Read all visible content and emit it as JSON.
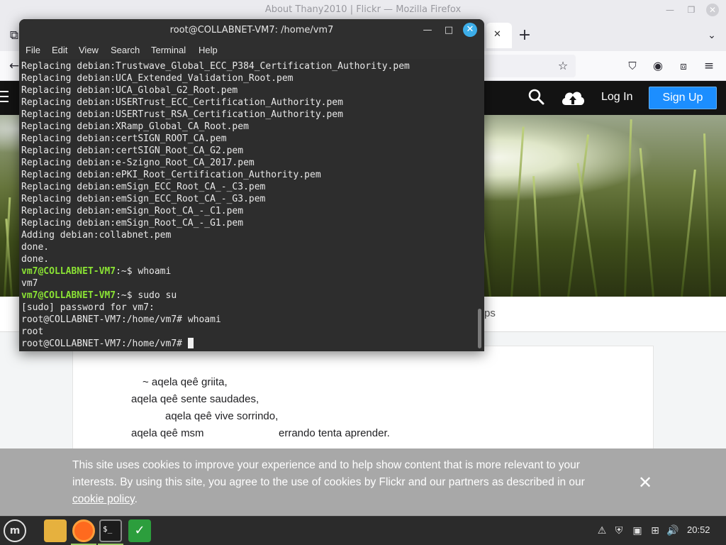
{
  "firefox": {
    "window_title": "About Thany2010 | Flickr — Mozilla Firefox",
    "tab_close": "✕",
    "new_tab": "+"
  },
  "flickr": {
    "login_label": "Log In",
    "signup_label": "Sign Up",
    "subnav_tail": "ps",
    "description_lines": [
      "~ aqela qeê griita,",
      "aqela qeê sente saudades,",
      "aqela qeê vive sorrindo,",
      "aqela qeê msm",
      "errando tenta aprender."
    ],
    "cookie_text": "This site uses cookies to improve your experience and to help show content that is more relevant to your interests. By using this site, you agree to the use of cookies by Flickr and our partners as described in our ",
    "cookie_link": "cookie policy",
    "cookie_end": "."
  },
  "terminal": {
    "title": "root@COLLABNET-VM7: /home/vm7",
    "menu": [
      "File",
      "Edit",
      "View",
      "Search",
      "Terminal",
      "Help"
    ],
    "lines": [
      "Replacing debian:Trustwave_Global_ECC_P384_Certification_Authority.pem",
      "Replacing debian:UCA_Extended_Validation_Root.pem",
      "Replacing debian:UCA_Global_G2_Root.pem",
      "Replacing debian:USERTrust_ECC_Certification_Authority.pem",
      "Replacing debian:USERTrust_RSA_Certification_Authority.pem",
      "Replacing debian:XRamp_Global_CA_Root.pem",
      "Replacing debian:certSIGN_ROOT_CA.pem",
      "Replacing debian:certSIGN_Root_CA_G2.pem",
      "Replacing debian:e-Szigno_Root_CA_2017.pem",
      "Replacing debian:ePKI_Root_Certification_Authority.pem",
      "Replacing debian:emSign_ECC_Root_CA_-_C3.pem",
      "Replacing debian:emSign_ECC_Root_CA_-_G3.pem",
      "Replacing debian:emSign_Root_CA_-_C1.pem",
      "Replacing debian:emSign_Root_CA_-_G1.pem",
      "Adding debian:collabnet.pem",
      "done.",
      "done."
    ],
    "prompt1_user": "vm7@COLLABNET-VM7",
    "prompt1_path": ":~$ ",
    "cmd1": "whoami",
    "out1": "vm7",
    "prompt2_user": "vm7@COLLABNET-VM7",
    "prompt2_path": ":~$ ",
    "cmd2": "sudo su",
    "sudo_prompt": "[sudo] password for vm7:",
    "root_prompt": "root@COLLABNET-VM7:/home/vm7# ",
    "cmd3": "whoami",
    "out3": "root",
    "final_prompt": "root@COLLABNET-VM7:/home/vm7# "
  },
  "taskbar": {
    "clock": "20:52",
    "term_glyph": "$_",
    "shield_glyph": "✓"
  }
}
